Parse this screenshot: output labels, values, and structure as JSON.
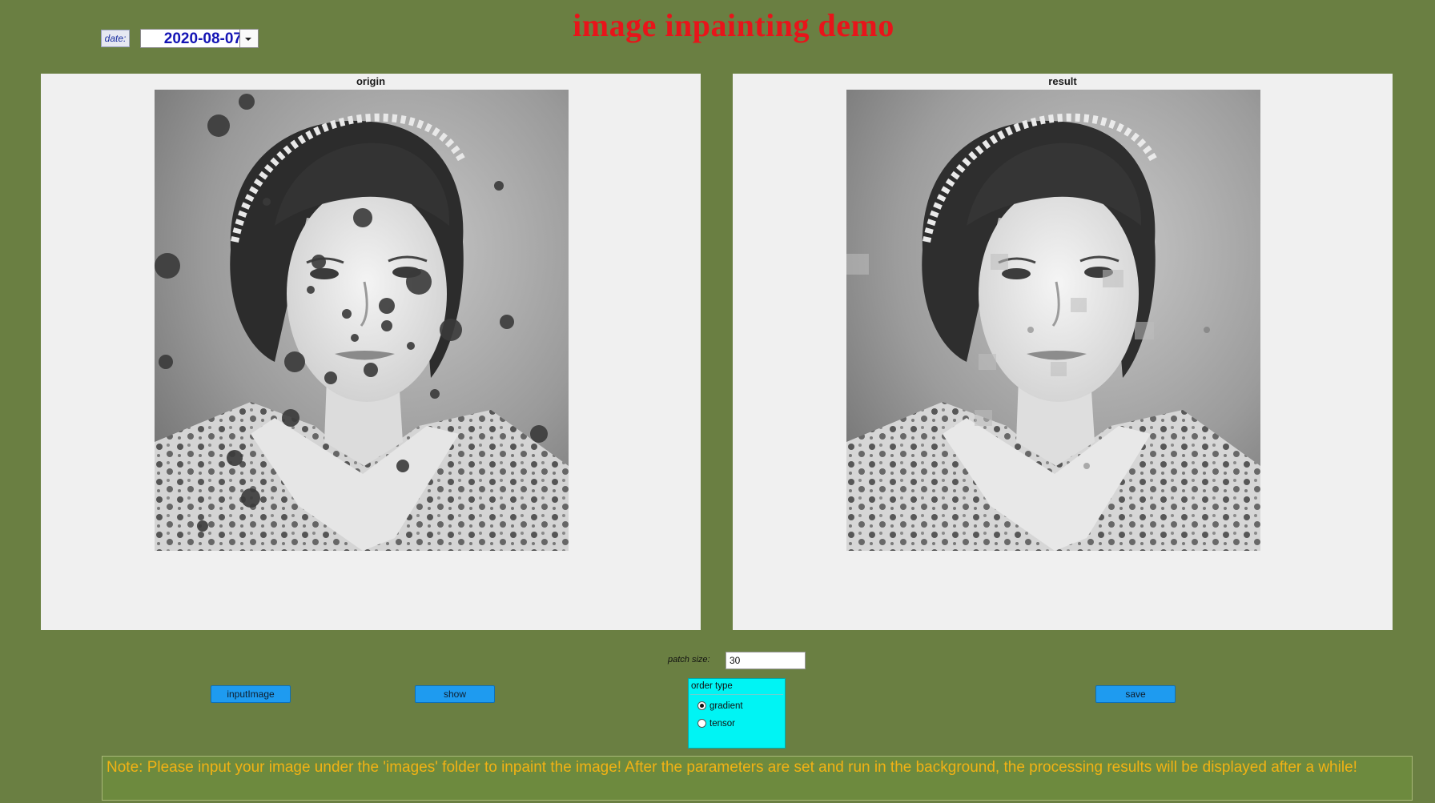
{
  "header": {
    "title": "image inpainting demo",
    "date_label": "date:",
    "date_value": "2020-08-07"
  },
  "panels": {
    "origin": {
      "title": "origin"
    },
    "result": {
      "title": "result"
    }
  },
  "controls": {
    "patch_size_label": "patch size:",
    "patch_size_value": "30",
    "input_image_label": "inputImage",
    "show_label": "show",
    "save_label": "save",
    "order_type": {
      "title": "order type",
      "options": [
        {
          "label": "gradient",
          "selected": true
        },
        {
          "label": "tensor",
          "selected": false
        }
      ]
    }
  },
  "note": "Note: Please input your image under the 'images' folder to inpaint the image! After the parameters are set and run in the background, the processing results will be displayed after a while!",
  "colors": {
    "background": "#6a7f42",
    "title": "#e8141a",
    "button": "#1e9bf0",
    "order_box": "#00f4f4",
    "note_text": "#f2b214"
  },
  "icons": [
    "chevron-down-icon",
    "radio-selected-icon",
    "radio-empty-icon"
  ]
}
